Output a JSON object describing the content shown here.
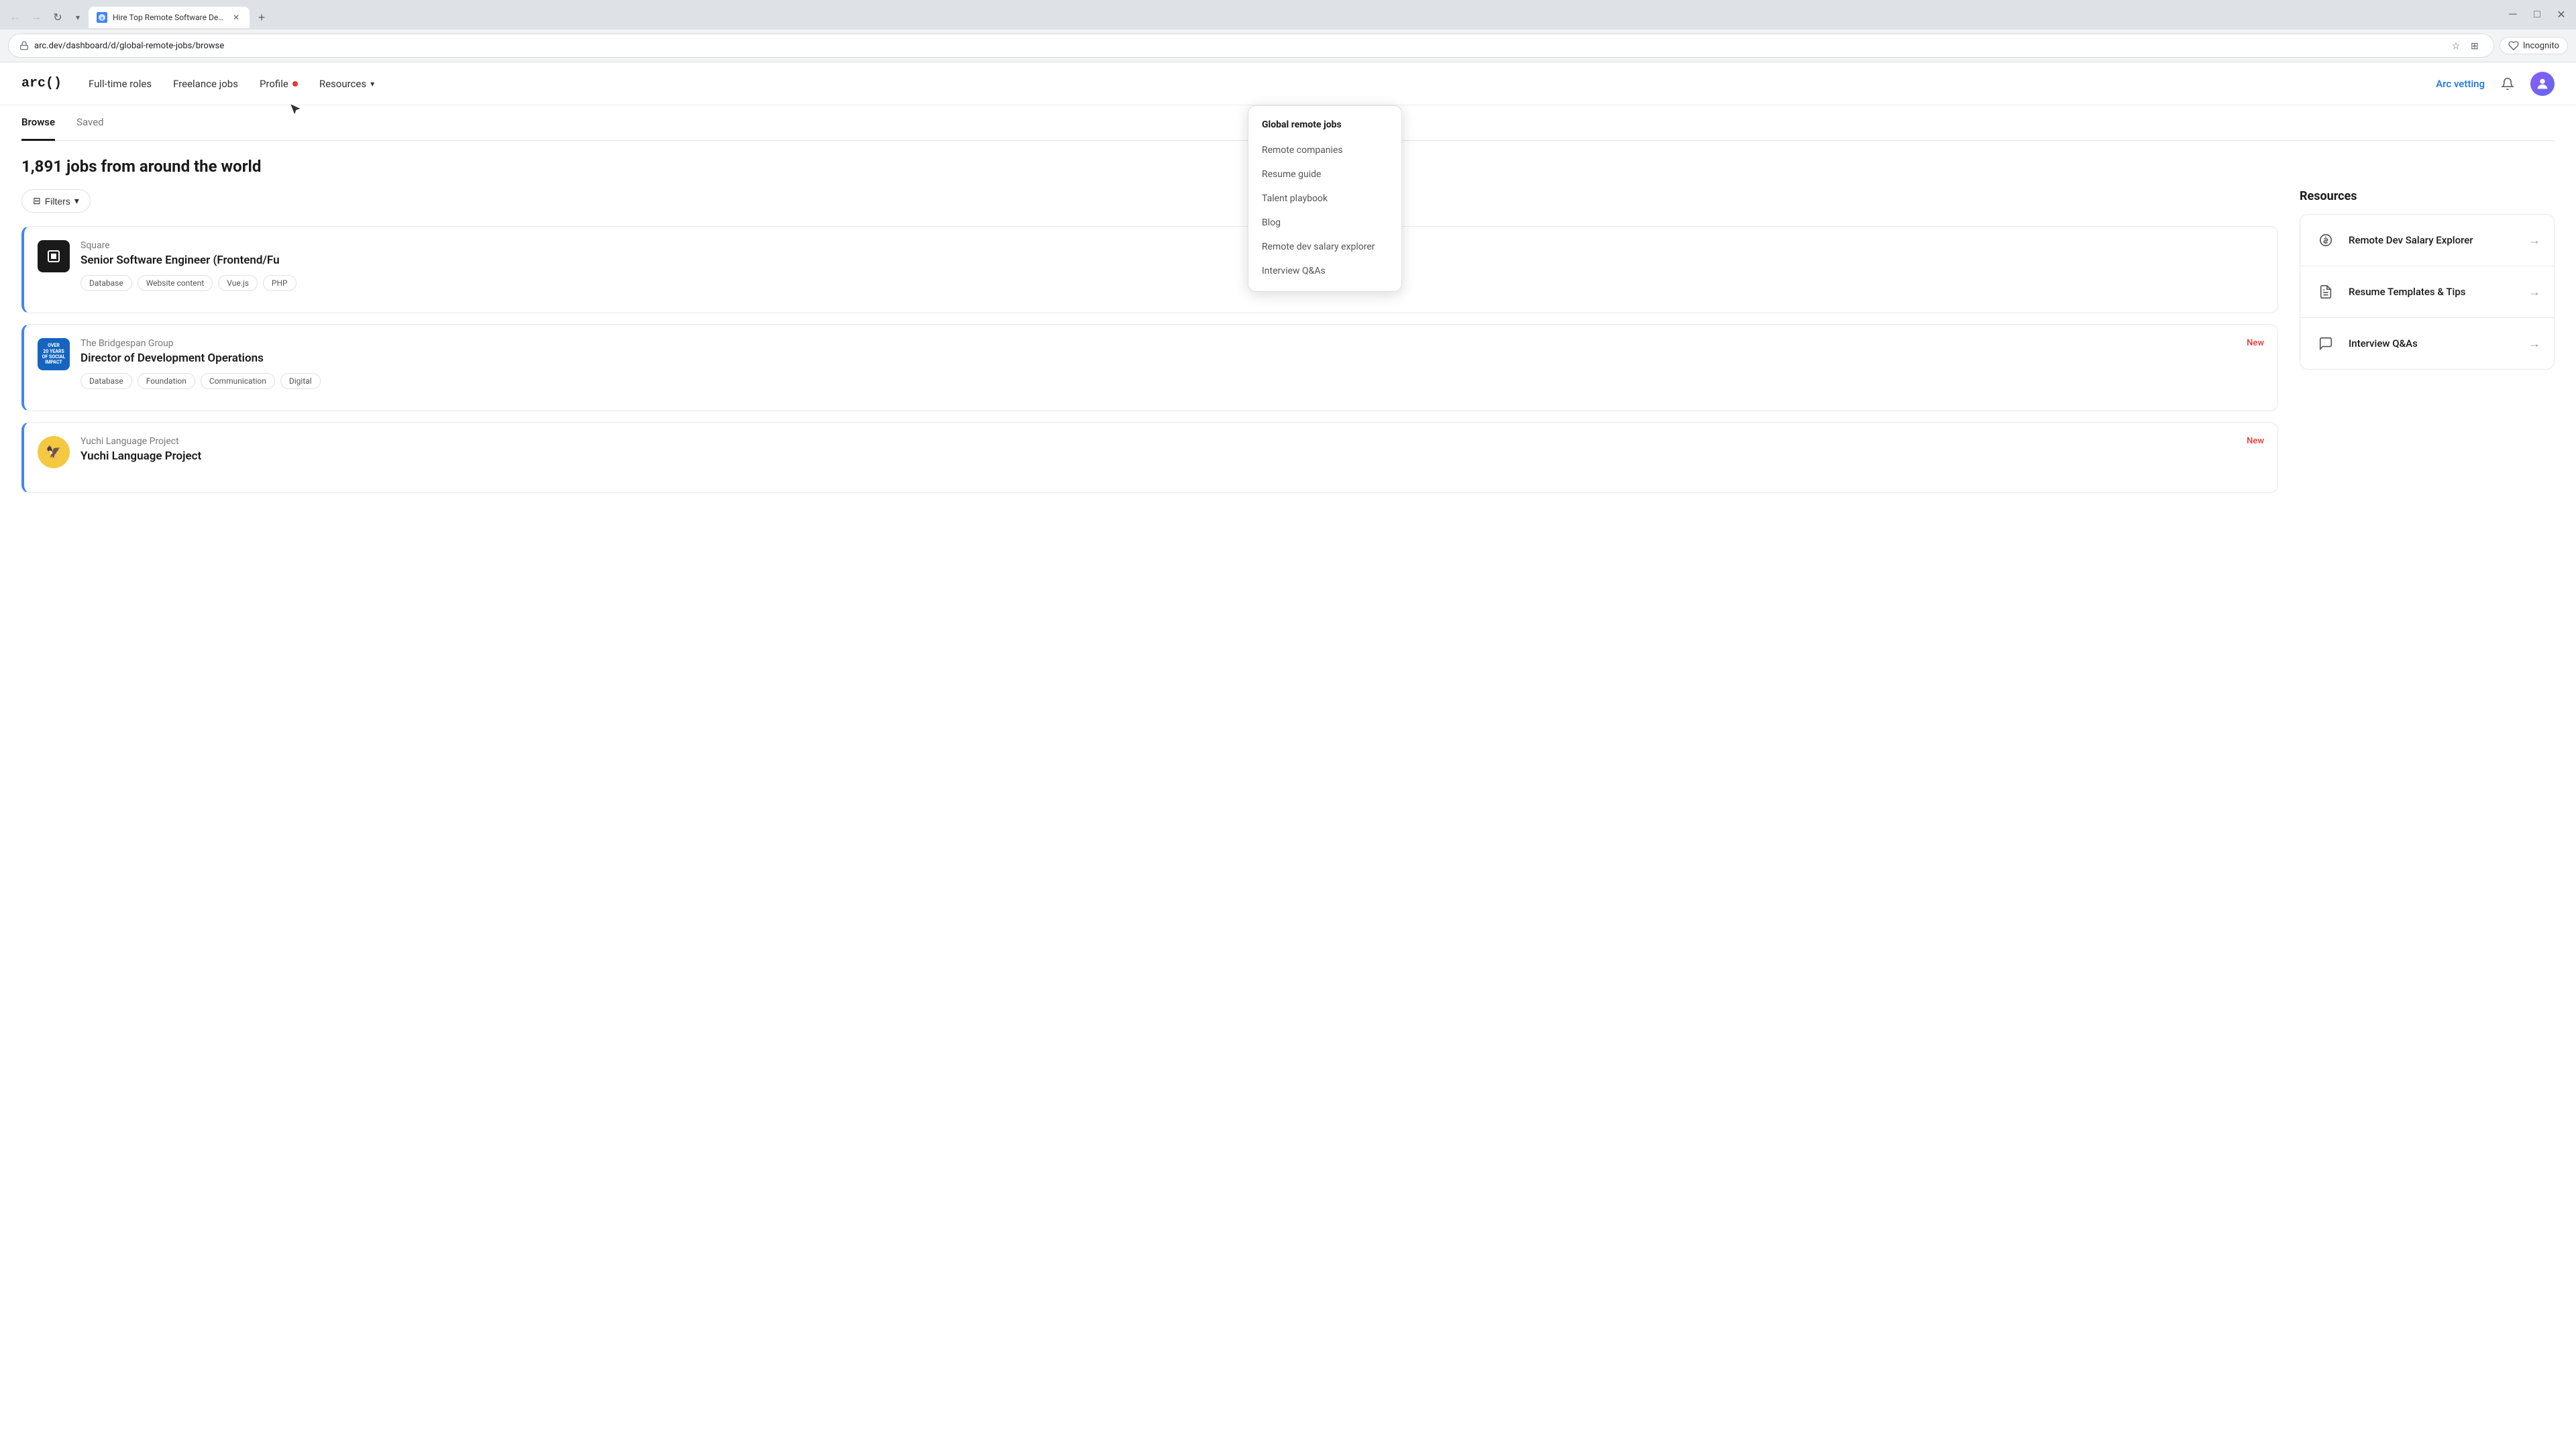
{
  "browser": {
    "tab_title": "Hire Top Remote Software Dev...",
    "tab_favicon": "A",
    "url": "arc.dev/dashboard/d/global-remote-jobs/browse",
    "incognito_label": "Incognito"
  },
  "nav": {
    "logo": "arc()",
    "items": [
      {
        "label": "Full-time roles",
        "id": "fulltime"
      },
      {
        "label": "Freelance jobs",
        "id": "freelance"
      },
      {
        "label": "Profile",
        "id": "profile",
        "has_dot": true
      },
      {
        "label": "Resources",
        "id": "resources",
        "has_chevron": true
      }
    ],
    "arc_vetting": "Arc vetting"
  },
  "resources_dropdown": {
    "section_title": "Global remote jobs",
    "items": [
      {
        "label": "Remote companies",
        "id": "remote-companies"
      },
      {
        "label": "Resume guide",
        "id": "resume-guide"
      },
      {
        "label": "Talent playbook",
        "id": "talent-playbook"
      },
      {
        "label": "Blog",
        "id": "blog"
      },
      {
        "label": "Remote dev salary explorer",
        "id": "salary-explorer"
      },
      {
        "label": "Interview Q&As",
        "id": "interview-qas"
      }
    ]
  },
  "browse": {
    "tabs": [
      {
        "label": "Browse",
        "active": true
      },
      {
        "label": "Saved",
        "active": false
      }
    ],
    "jobs_count": "1,891 jobs from around the world",
    "filter_label": "Filters"
  },
  "jobs": [
    {
      "company": "Square",
      "title": "Senior Software Engineer (Frontend/Fu",
      "tags": [
        "Database",
        "Website content",
        "Vue.js",
        "PHP"
      ],
      "is_new": false,
      "logo_type": "square"
    },
    {
      "company": "The Bridgespan Group",
      "title": "Director of Development Operations",
      "tags": [
        "Database",
        "Foundation",
        "Communication",
        "Digital"
      ],
      "is_new": true,
      "new_label": "New",
      "logo_type": "bridgespan"
    },
    {
      "company": "Yuchi Language Project",
      "title": "Yuchi Language Project",
      "tags": [],
      "is_new": true,
      "new_label": "New",
      "logo_type": "yuchi"
    }
  ],
  "resources_sidebar": {
    "title": "Resources",
    "items": [
      {
        "label": "Remote Dev Salary Explorer",
        "icon": "💰",
        "id": "salary-explorer"
      },
      {
        "label": "Resume Templates & Tips",
        "icon": "📄",
        "id": "resume-templates"
      },
      {
        "label": "Interview Q&As",
        "icon": "💬",
        "id": "interview-qas"
      }
    ]
  },
  "icons": {
    "back": "←",
    "forward": "→",
    "refresh": "↻",
    "bookmark": "☆",
    "extensions": "⊞",
    "chevron_down": "▾",
    "bell": "🔔",
    "filter": "⊟",
    "arrow_right": "→",
    "close": "✕",
    "minimize": "─",
    "maximize": "□"
  }
}
